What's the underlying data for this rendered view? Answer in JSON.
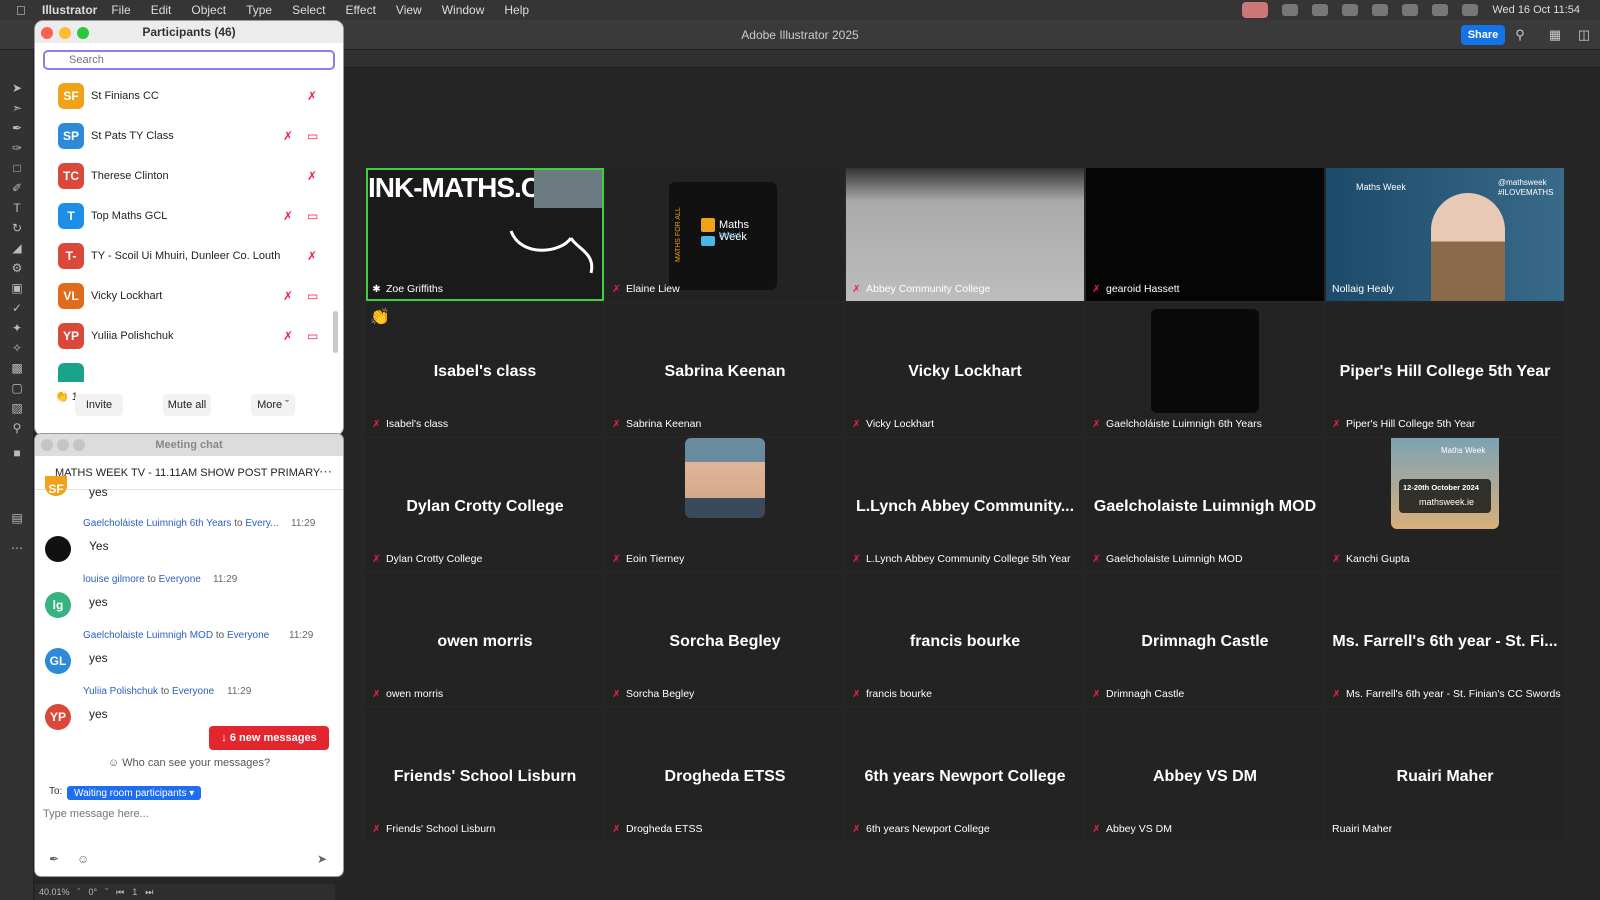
{
  "menubar": {
    "app": "Illustrator",
    "items": [
      "File",
      "Edit",
      "Object",
      "Type",
      "Select",
      "Effect",
      "View",
      "Window",
      "Help"
    ],
    "clock": "Wed 16 Oct  11:54"
  },
  "ai": {
    "title": "Adobe Illustrator 2025",
    "share_label": "Share"
  },
  "participants": {
    "title": "Participants (46)",
    "search_placeholder": "Search",
    "rows": [
      {
        "initials": "SF",
        "name": "St Finians CC",
        "color": "#f0a21a",
        "cam_off": false
      },
      {
        "initials": "SP",
        "name": "St Pats TY Class",
        "color": "#2e8ad8",
        "cam_off": true
      },
      {
        "initials": "TC",
        "name": "Therese Clinton",
        "color": "#d9483b",
        "cam_off": false
      },
      {
        "initials": "T",
        "name": "Top Maths GCL",
        "color": "#1d8fe8",
        "cam_off": true
      },
      {
        "initials": "T-",
        "name": "TY - Scoil Ui Mhuiri, Dunleer Co. Louth",
        "color": "#d9483b",
        "cam_off": false
      },
      {
        "initials": "VL",
        "name": "Vicky Lockhart",
        "color": "#e06b1b",
        "cam_off": true
      },
      {
        "initials": "YP",
        "name": "Yuliia Polishchuk",
        "color": "#d9483b",
        "cam_off": true
      }
    ],
    "reaction_count": "1",
    "invite_label": "Invite",
    "mute_all_label": "Mute all",
    "more_label": "More"
  },
  "chat": {
    "title": "Meeting chat",
    "header": "MATHS WEEK TV - 11.11AM SHOW POST PRIMARY",
    "first_text": "yes",
    "first_initials": "SF",
    "messages": [
      {
        "sender": "Gaelcholáiste Luimnigh 6th Years",
        "to_word": "to",
        "recipient": "Every...",
        "time": "11:29",
        "text": "Yes",
        "initials": "",
        "color": "#111111"
      },
      {
        "sender": "louise gilmore",
        "to_word": "to",
        "recipient": "Everyone",
        "time": "11:29",
        "text": "yes",
        "initials": "lg",
        "color": "#36b37e"
      },
      {
        "sender": "Gaelcholaiste Luimnigh MOD",
        "to_word": "to",
        "recipient": "Everyone",
        "time": "11:29",
        "text": "yes",
        "initials": "GL",
        "color": "#2e8ad8"
      },
      {
        "sender": "Yuliia Polishchuk",
        "to_word": "to",
        "recipient": "Everyone",
        "time": "11:29",
        "text": "yes",
        "initials": "YP",
        "color": "#d9483b"
      }
    ],
    "new_messages": "↓ 6 new messages",
    "who_can_see": "Who can see your messages?",
    "to_label": "To:",
    "to_value": "Waiting room participants ▾",
    "input_placeholder": "Type message here..."
  },
  "status": {
    "zoom": "40.01%",
    "rotation": "0°",
    "artboard": "1"
  },
  "tiles": [
    {
      "display": "INK-MATHS.C",
      "label": "Zoe Griffiths",
      "kind": "video",
      "muted": false
    },
    {
      "display": "",
      "label": "Elaine Liew",
      "kind": "logo",
      "muted": true
    },
    {
      "display": "",
      "label": "Abbey Community College",
      "kind": "room",
      "muted": true
    },
    {
      "display": "",
      "label": "gearoid Hassett",
      "kind": "black",
      "muted": true
    },
    {
      "display": "",
      "label": "Nollaig Healy",
      "kind": "person",
      "muted": false
    },
    {
      "display": "Isabel's class",
      "label": "Isabel's class",
      "kind": "name",
      "muted": true
    },
    {
      "display": "Sabrina Keenan",
      "label": "Sabrina Keenan",
      "kind": "name",
      "muted": true
    },
    {
      "display": "Vicky Lockhart",
      "label": "Vicky Lockhart",
      "kind": "name",
      "muted": true
    },
    {
      "display": "",
      "label": "Gaelcholáiste Luimnigh 6th Years",
      "kind": "darkbox",
      "muted": true
    },
    {
      "display": "Piper's Hill College 5th Year",
      "label": "Piper's Hill College 5th Year",
      "kind": "name",
      "muted": true
    },
    {
      "display": "Dylan Crotty College",
      "label": "Dylan Crotty College",
      "kind": "name",
      "muted": true
    },
    {
      "display": "",
      "label": "Eoin Tierney",
      "kind": "photo",
      "muted": true
    },
    {
      "display": "L.Lynch Abbey Community...",
      "label": "L.Lynch Abbey Community College 5th Year",
      "kind": "name",
      "muted": true
    },
    {
      "display": "Gaelcholaiste Luimnigh MOD",
      "label": "Gaelcholaiste Luimnigh MOD",
      "kind": "name",
      "muted": true
    },
    {
      "display": "",
      "label": "Kanchi Gupta",
      "kind": "poster",
      "muted": true
    },
    {
      "display": "owen morris",
      "label": "owen morris",
      "kind": "name",
      "muted": true
    },
    {
      "display": "Sorcha Begley",
      "label": "Sorcha Begley",
      "kind": "name",
      "muted": true
    },
    {
      "display": "francis bourke",
      "label": "francis bourke",
      "kind": "name",
      "muted": true
    },
    {
      "display": "Drimnagh Castle",
      "label": "Drimnagh Castle",
      "kind": "name",
      "muted": true
    },
    {
      "display": "Ms. Farrell's 6th year - St. Fi...",
      "label": "Ms. Farrell's 6th year - St. Finian's CC Swords",
      "kind": "name",
      "muted": true
    },
    {
      "display": "Friends' School Lisburn",
      "label": "Friends' School Lisburn",
      "kind": "name",
      "muted": true
    },
    {
      "display": "Drogheda ETSS",
      "label": "Drogheda ETSS",
      "kind": "name",
      "muted": true
    },
    {
      "display": "6th years Newport College",
      "label": "6th years Newport College",
      "kind": "name",
      "muted": true
    },
    {
      "display": "Abbey VS DM",
      "label": "Abbey VS DM",
      "kind": "name",
      "muted": true
    },
    {
      "display": "Ruairi Maher",
      "label": "Ruairi Maher",
      "kind": "name",
      "muted": false
    }
  ],
  "logo_text": {
    "maths_week": "Maths Week",
    "ireland": "Ireland",
    "for_all": "MATHS FOR ALL",
    "poster_date": "12-20th October 2024",
    "poster_url": "mathsweek.ie",
    "hashtag": "#ILOVEMATHS",
    "handle": "@mathsweek"
  }
}
